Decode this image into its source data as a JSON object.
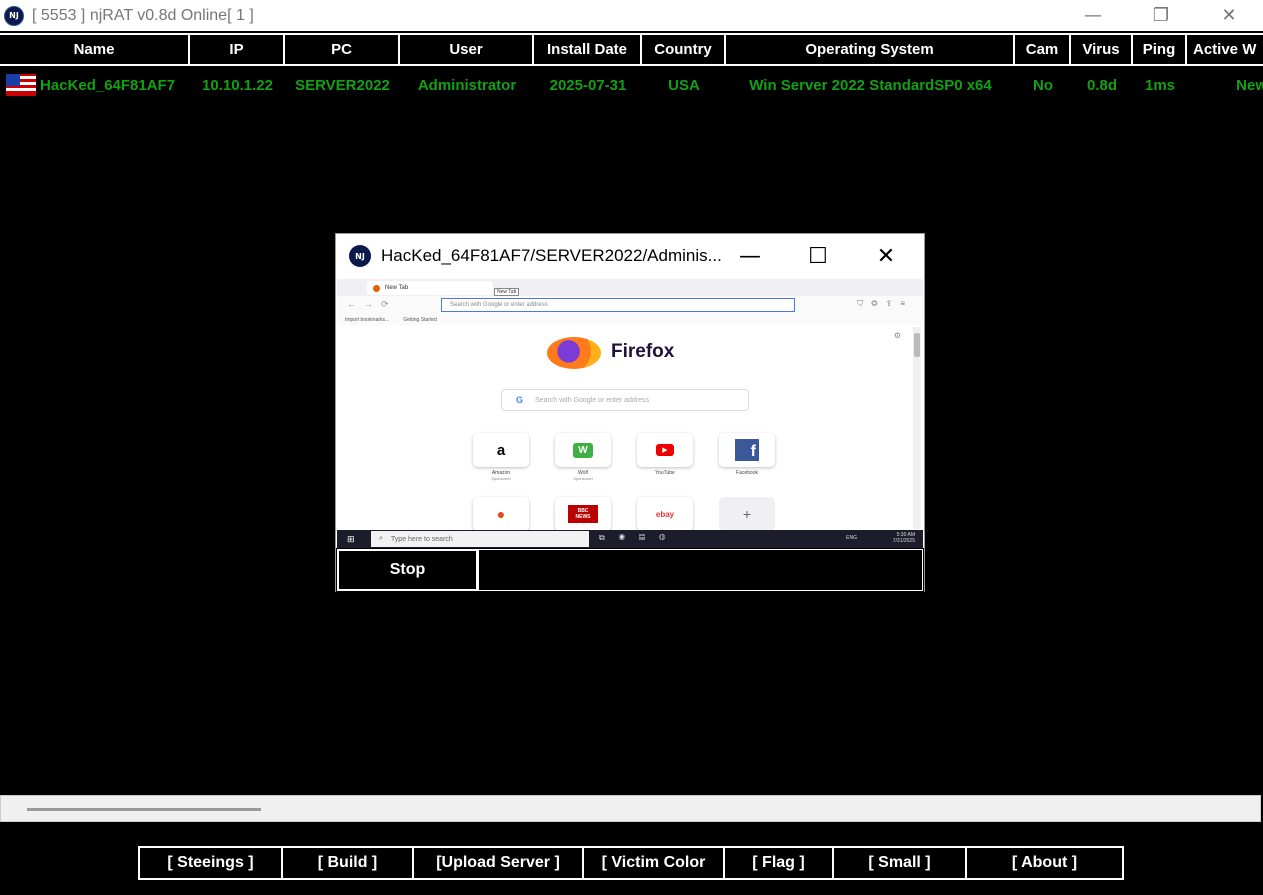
{
  "window": {
    "title": "[ 5553 ] njRAT v0.8d Online[ 1 ]",
    "icon_label": "NJ",
    "controls": [
      "minimize-icon",
      "restore-icon",
      "close-icon"
    ]
  },
  "table": {
    "columns": [
      "Name",
      "IP",
      "PC",
      "User",
      "Install Date",
      "Country",
      "Operating System",
      "Cam",
      "Virus",
      "Ping",
      "Active W"
    ],
    "rows": [
      {
        "flag": "usa-flag-icon",
        "name": "HacKed_64F81AF7",
        "ip": "10.10.1.22",
        "pc": "SERVER2022",
        "user": "Administrator",
        "install_date": "2025-07-31",
        "country": "USA",
        "os": "Win Server 2022 StandardSP0 x64",
        "cam": "No",
        "virus": "0.8d",
        "ping": "1ms",
        "active_window": "New"
      }
    ],
    "row_text_color": "#13a113"
  },
  "remote_desktop": {
    "title": "HacKed_64F81AF7/SERVER2022/Adminis...",
    "icon_label": "NJ",
    "stop_label": "Stop",
    "screen": {
      "tab_label": "New Tab",
      "tooltip": "New Tab",
      "url_placeholder": "Search with Google or enter address",
      "bookmarks": [
        "Import bookmarks...",
        "Getting Started"
      ],
      "brand": "Firefox",
      "search_placeholder": "Search with Google or enter address",
      "shortcuts": [
        {
          "label": "Amazon",
          "sub": "Sponsored",
          "glyph": "a"
        },
        {
          "label": "Wolf",
          "sub": "Sponsored",
          "glyph": "W"
        },
        {
          "label": "YouTube",
          "sub": "",
          "glyph": "▶"
        },
        {
          "label": "Facebook",
          "sub": "",
          "glyph": "f"
        },
        {
          "label": "",
          "sub": "",
          "glyph": "●"
        },
        {
          "label": "",
          "sub": "",
          "glyph": "BBC NEWS"
        },
        {
          "label": "",
          "sub": "",
          "glyph": "ebay"
        },
        {
          "label": "",
          "sub": "",
          "glyph": "+"
        }
      ],
      "taskbar_search": "Type here to search",
      "tray_lang": "ENG",
      "tray_time": "5:30 AM",
      "tray_date": "7/31/2025"
    }
  },
  "bottom_buttons": [
    "[ Steeings ]",
    "[ Build ]",
    "[Upload Server ]",
    "[ Victim Color",
    "[ Flag ]",
    "[ Small ]",
    "[ About ]"
  ]
}
